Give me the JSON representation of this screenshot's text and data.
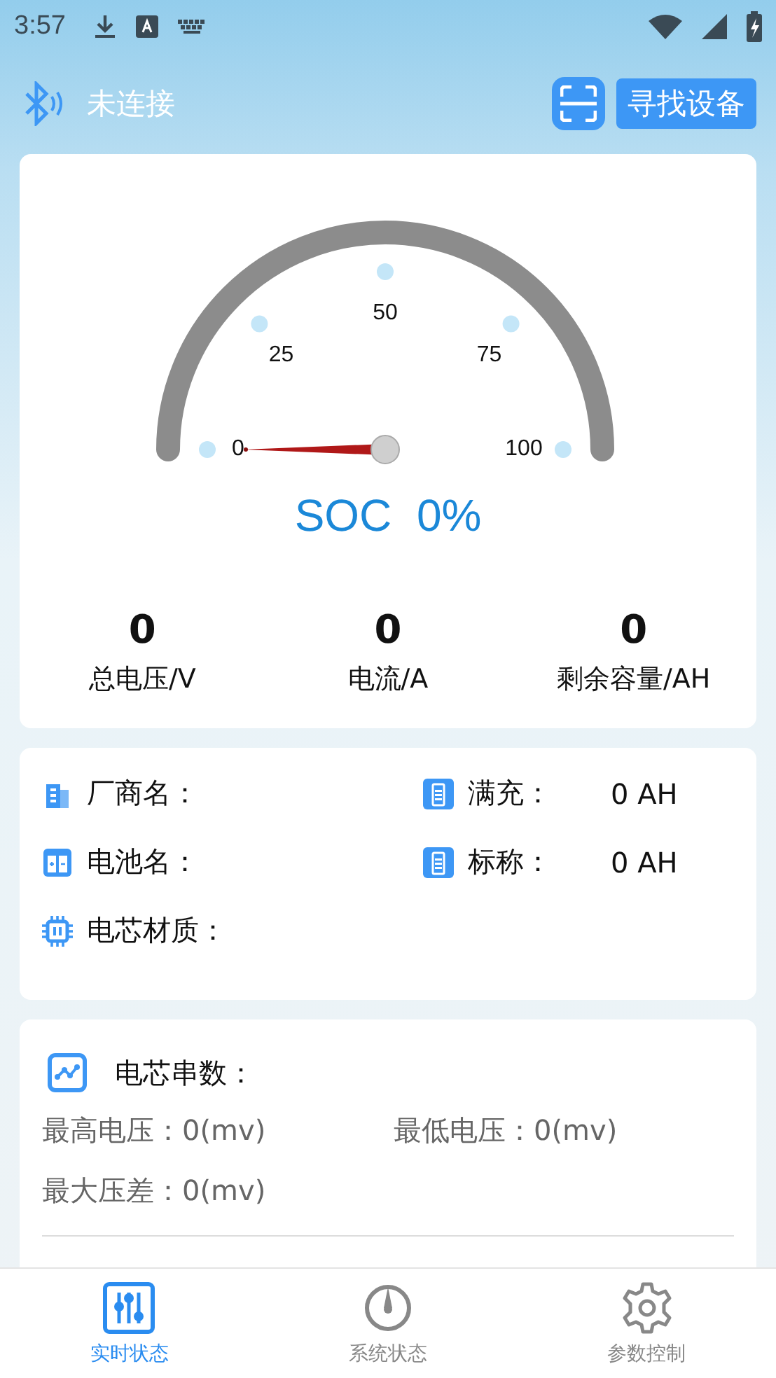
{
  "status_bar": {
    "time": "3:57"
  },
  "header": {
    "connection": "未连接",
    "find_button": "寻找设备"
  },
  "gauge": {
    "level": 0,
    "ticks": [
      "0",
      "25",
      "50",
      "75",
      "100"
    ],
    "reading": "SOC  0%"
  },
  "stats": [
    {
      "value": "0",
      "label": "总电压/V"
    },
    {
      "value": "0",
      "label": "电流/A"
    },
    {
      "value": "0",
      "label": "剩余容量/AH"
    }
  ],
  "info": [
    {
      "kind": "building",
      "label": "厂商名："
    },
    {
      "kind": "battery",
      "label": "满充：",
      "value": "0 AH"
    },
    {
      "kind": "cells",
      "label": "电池名："
    },
    {
      "kind": "battery",
      "label": "标称：",
      "value": "0 AH"
    },
    {
      "kind": "chip",
      "label": "电芯材质："
    }
  ],
  "cells": {
    "title": "电芯串数：",
    "rows": [
      "最高电压：0(mv)",
      "最低电压：0(mv)",
      "最大压差：0(mv)"
    ]
  },
  "nav": [
    {
      "kind": "sliders",
      "label": "实时状态",
      "selected": true
    },
    {
      "kind": "gauge",
      "label": "系统状态",
      "selected": false
    },
    {
      "kind": "gear",
      "label": "参数控制",
      "selected": false
    }
  ]
}
